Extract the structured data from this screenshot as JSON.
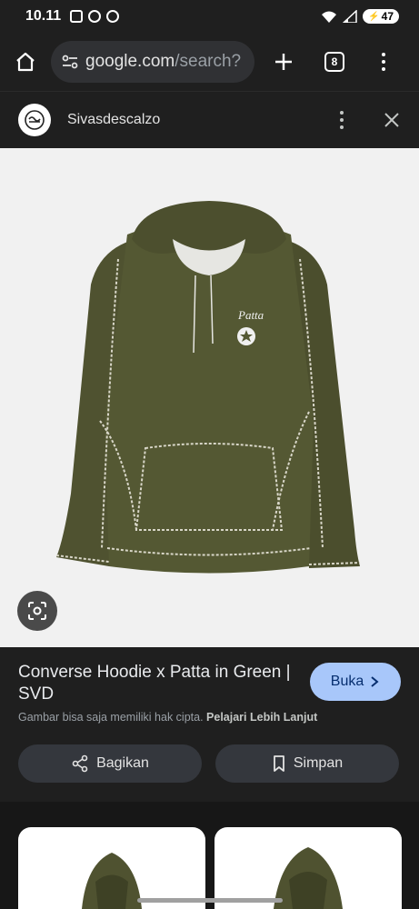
{
  "status_bar": {
    "time": "10.11",
    "battery": "47"
  },
  "browser": {
    "url_host": "google.com",
    "url_rest": "/search?",
    "tab_count": "8"
  },
  "site": {
    "name": "Sivasdescalzo"
  },
  "product": {
    "title": "Converse Hoodie x Patta in Green | SVD",
    "visit_label": "Buka",
    "copyright_notice": "Gambar bisa saja memiliki hak cipta.",
    "learn_more": "Pelajari Lebih Lanjut",
    "image_logo_text": "Patta"
  },
  "actions": {
    "share_label": "Bagikan",
    "save_label": "Simpan"
  },
  "colors": {
    "hoodie": "#4f5230",
    "visit_button": "#a8c7fa"
  }
}
